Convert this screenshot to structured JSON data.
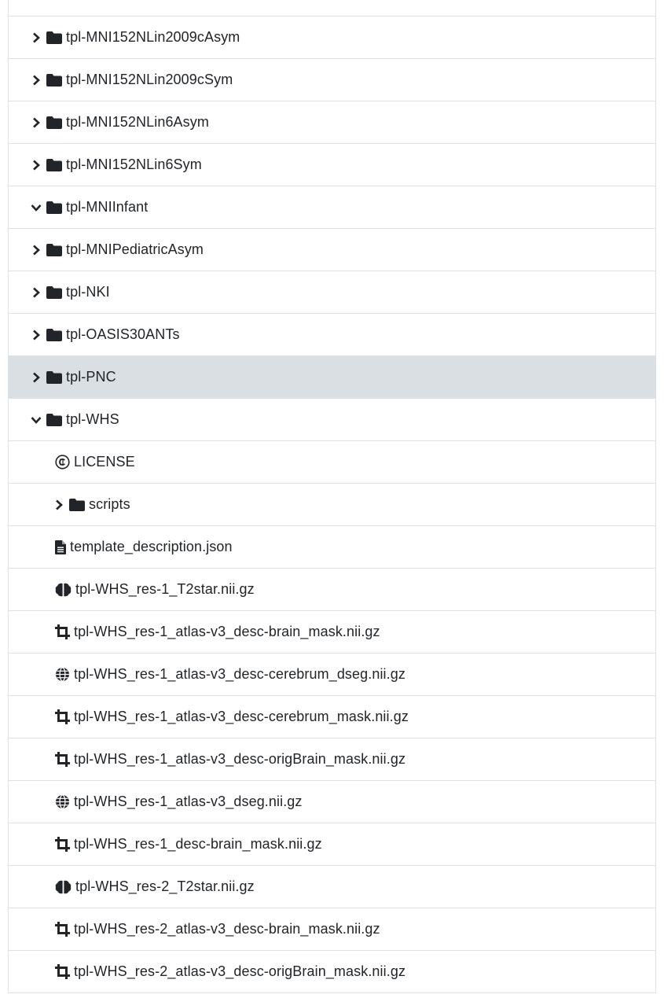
{
  "tree": {
    "rows": [
      {
        "label": "tpl-MNI152NLin2009cAsym",
        "icon": "folder-icon",
        "chevron": "chevron-right-icon"
      },
      {
        "label": "tpl-MNI152NLin2009cSym",
        "icon": "folder-icon",
        "chevron": "chevron-right-icon"
      },
      {
        "label": "tpl-MNI152NLin6Asym",
        "icon": "folder-icon",
        "chevron": "chevron-right-icon"
      },
      {
        "label": "tpl-MNI152NLin6Sym",
        "icon": "folder-icon",
        "chevron": "chevron-right-icon"
      },
      {
        "label": "tpl-MNIInfant",
        "icon": "folder-icon",
        "chevron": "chevron-down-icon"
      },
      {
        "label": "tpl-MNIPediatricAsym",
        "icon": "folder-icon",
        "chevron": "chevron-right-icon"
      },
      {
        "label": "tpl-NKI",
        "icon": "folder-icon",
        "chevron": "chevron-right-icon"
      },
      {
        "label": "tpl-OASIS30ANTs",
        "icon": "folder-icon",
        "chevron": "chevron-right-icon"
      },
      {
        "label": "tpl-PNC",
        "icon": "folder-icon",
        "chevron": "chevron-right-icon",
        "highlight": true
      },
      {
        "label": "tpl-WHS",
        "icon": "folder-icon",
        "chevron": "chevron-down-icon"
      }
    ],
    "whs_children": [
      {
        "label": "LICENSE",
        "icon": "copyright-icon"
      },
      {
        "label": "scripts",
        "icon": "folder-icon",
        "chevron": "chevron-right-icon"
      },
      {
        "label": "template_description.json",
        "icon": "file-text-icon"
      },
      {
        "label": "tpl-WHS_res-1_T2star.nii.gz",
        "icon": "brain-icon"
      },
      {
        "label": "tpl-WHS_res-1_atlas-v3_desc-brain_mask.nii.gz",
        "icon": "crop-icon"
      },
      {
        "label": "tpl-WHS_res-1_atlas-v3_desc-cerebrum_dseg.nii.gz",
        "icon": "globe-icon"
      },
      {
        "label": "tpl-WHS_res-1_atlas-v3_desc-cerebrum_mask.nii.gz",
        "icon": "crop-icon"
      },
      {
        "label": "tpl-WHS_res-1_atlas-v3_desc-origBrain_mask.nii.gz",
        "icon": "crop-icon"
      },
      {
        "label": "tpl-WHS_res-1_atlas-v3_dseg.nii.gz",
        "icon": "globe-icon"
      },
      {
        "label": "tpl-WHS_res-1_desc-brain_mask.nii.gz",
        "icon": "crop-icon"
      },
      {
        "label": "tpl-WHS_res-2_T2star.nii.gz",
        "icon": "brain-icon"
      },
      {
        "label": "tpl-WHS_res-2_atlas-v3_desc-brain_mask.nii.gz",
        "icon": "crop-icon"
      },
      {
        "label": "tpl-WHS_res-2_atlas-v3_desc-origBrain_mask.nii.gz",
        "icon": "crop-icon"
      }
    ]
  },
  "colors": {
    "border": "#dee2e6",
    "highlight": "#dadfe3",
    "text": "#212529"
  }
}
